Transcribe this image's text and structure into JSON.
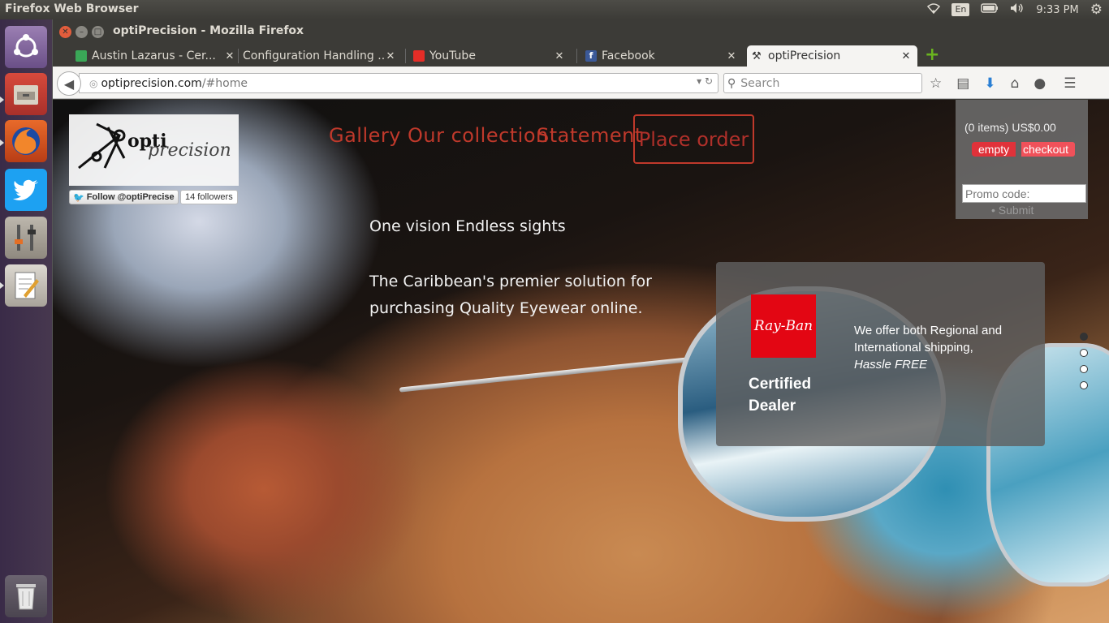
{
  "top_panel": {
    "app_title": "Firefox Web Browser",
    "keyboard_layout": "En",
    "clock": "9:33 PM",
    "icons": [
      "wifi-icon",
      "battery-icon",
      "volume-icon",
      "settings-gear-icon"
    ]
  },
  "launcher": {
    "items": [
      "ubuntu-dash-icon",
      "files-icon",
      "firefox-icon",
      "twitter-icon",
      "system-settings-icon",
      "text-editor-icon",
      "trash-icon"
    ]
  },
  "window": {
    "title": "optiPrecision - Mozilla Firefox"
  },
  "tabs": [
    {
      "label": "Austin Lazarus - Cer...",
      "favicon": "green-profile-icon",
      "favicon_color": "#3aa757"
    },
    {
      "label": "Configuration Handling ...",
      "favicon": "none"
    },
    {
      "label": "YouTube",
      "favicon": "youtube-icon",
      "favicon_color": "#e52d27"
    },
    {
      "label": "Facebook",
      "favicon": "facebook-icon",
      "favicon_color": "#3b5998"
    },
    {
      "label": "optiPrecision",
      "favicon": "opti-tool-icon",
      "active": true
    }
  ],
  "navbar": {
    "url_host": "optiprecision.com",
    "url_path": "/#home",
    "search_placeholder": "Search"
  },
  "page": {
    "logo": {
      "opti": "opti",
      "precision": "precision"
    },
    "twitter": {
      "follow_label": "Follow @optiPrecise",
      "followers": "14 followers"
    },
    "nav": {
      "gallery": "Gallery",
      "collection": "Our collection",
      "statement": "Statement",
      "place_order": "Place order"
    },
    "tagline": "One vision Endless sights",
    "description": "The Caribbean's premier solution for purchasing Quality Eyewear online.",
    "cart": {
      "total": "(0 items) US$0.00",
      "empty_label": "empty",
      "checkout_label": "checkout",
      "promo_placeholder": "Promo code:",
      "submit_label": "Submit"
    },
    "info": {
      "brand": "Ray-Ban",
      "certified": "Certified Dealer",
      "shipping": "We offer both Regional and International shipping,",
      "hassle": "Hassle FREE"
    },
    "slider_active_index": 0
  },
  "colors": {
    "accent_red": "#c0392b",
    "rayban_red": "#e30613",
    "cart_red": "#e0323a"
  }
}
